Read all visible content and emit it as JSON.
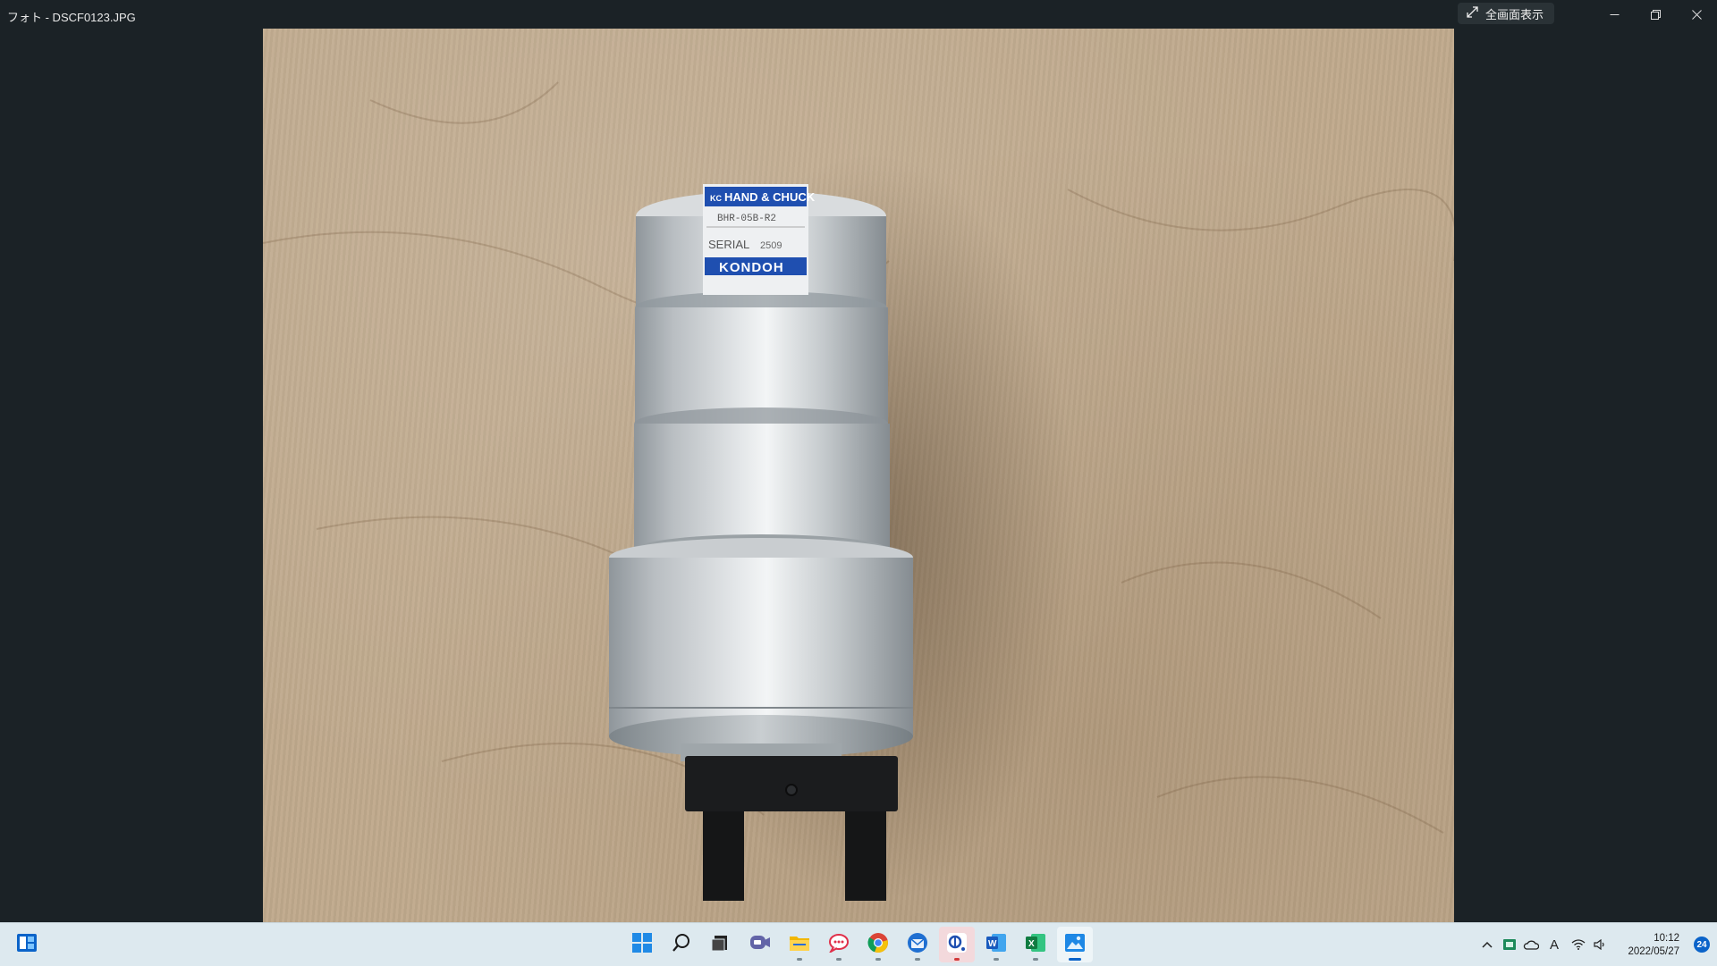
{
  "window": {
    "title": "フォト - DSCF0123.JPG",
    "fullscreen_label": "全画面表示"
  },
  "photo": {
    "label_brand": "HAND & CHUCK",
    "label_model": "BHR-05B-R2",
    "label_serial_text": "SERIAL",
    "label_serial_number": "2509",
    "label_maker": "KONDOH"
  },
  "taskbar": {
    "apps": [
      {
        "name": "start-icon"
      },
      {
        "name": "search-icon"
      },
      {
        "name": "task-view-icon"
      },
      {
        "name": "teams-chat-icon"
      },
      {
        "name": "file-explorer-icon"
      },
      {
        "name": "messaging-app-icon"
      },
      {
        "name": "chrome-icon"
      },
      {
        "name": "thunderbird-icon"
      },
      {
        "name": "app-icon"
      },
      {
        "name": "word-icon"
      },
      {
        "name": "excel-icon"
      },
      {
        "name": "photos-icon"
      }
    ],
    "clock_time": "10:12",
    "clock_date": "2022/05/27",
    "notification_count": "24",
    "ime_indicator": "A"
  },
  "colors": {
    "window_bg": "#1b2226",
    "taskbar_bg": "#dde9ef",
    "accent": "#0a63c9",
    "label_blue": "#1f4fb0"
  }
}
